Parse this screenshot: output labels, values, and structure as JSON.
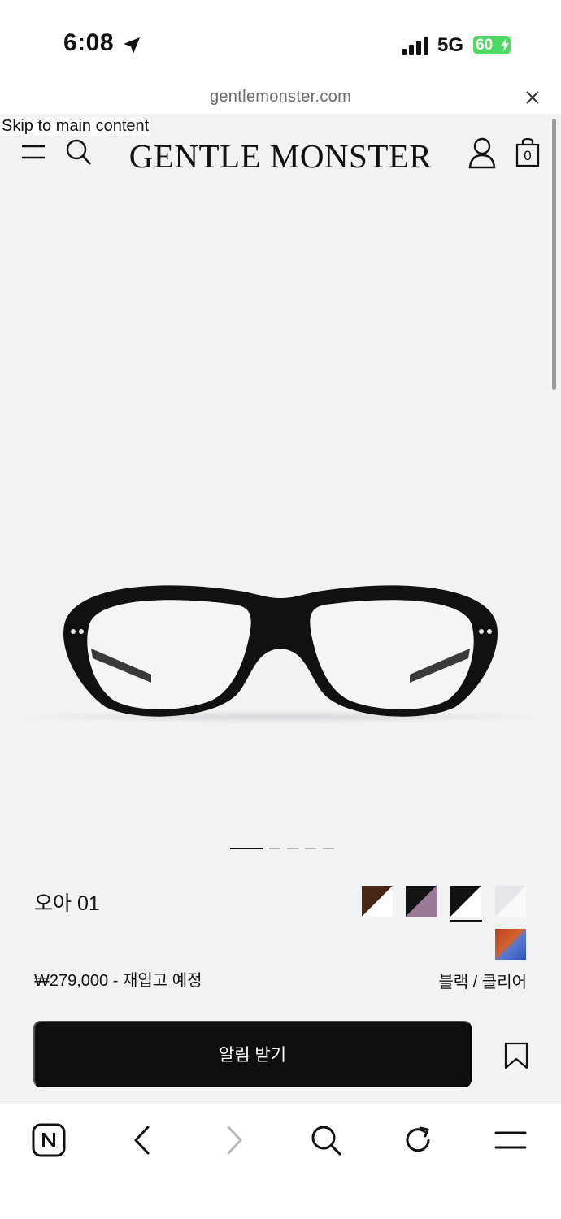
{
  "status_bar": {
    "time": "6:08",
    "network": "5G",
    "battery": "60",
    "icons": [
      "location-arrow-icon",
      "signal-bars-icon",
      "battery-icon"
    ]
  },
  "browser": {
    "url": "gentlemonster.com",
    "toolbar_icons": [
      "naver-n-icon",
      "back-arrow-icon",
      "forward-arrow-icon",
      "search-icon",
      "reload-icon",
      "menu-icon"
    ]
  },
  "site": {
    "skip_link": "Skip to main content",
    "logo": "GENTLE MONSTER",
    "cart_count": "0",
    "header_icons": [
      "hamburger-menu-icon",
      "search-icon",
      "account-icon",
      "shopping-bag-icon"
    ]
  },
  "product": {
    "name": "오아 01",
    "price_line": "₩279,000 - 재입고 예정",
    "color_name": "블랙 / 클리어",
    "notify_label": "알림 받기",
    "carousel": {
      "total": 5,
      "active": 1
    },
    "swatches": [
      {
        "name": "brown",
        "colors": [
          "#4a2616",
          "#ffffff"
        ]
      },
      {
        "name": "black-purple",
        "colors": [
          "#141414",
          "#9a7a96"
        ]
      },
      {
        "name": "black-clear",
        "colors": [
          "#111111",
          "#ffffff"
        ],
        "selected": true
      },
      {
        "name": "clear",
        "colors": [
          "#e4e6ea",
          "#f6f7f9"
        ]
      },
      {
        "name": "orange-blue",
        "colors": [
          "#c44a22",
          "#3d63c6"
        ]
      }
    ]
  },
  "colors": {
    "page_bg": "#f1f2f4",
    "button_bg": "#0f0f0f",
    "battery_green": "#4cd964"
  }
}
